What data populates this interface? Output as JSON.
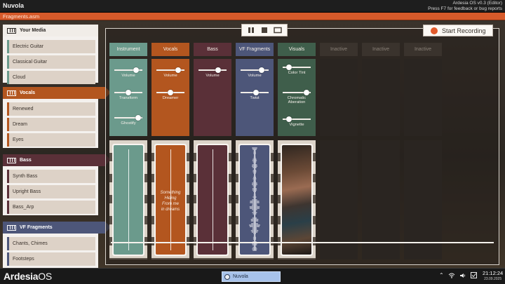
{
  "window": {
    "app_title": "Nuvola",
    "os_version": "Ardesia OS v0.3 (Editor)",
    "feedback_hint": "Press F7 for feedback or bug reports",
    "file_name": "Fragments.asm"
  },
  "sidebar": {
    "groups": [
      {
        "header": "Your Media",
        "color": "#f1ede8",
        "items": [
          {
            "label": "Electric Guitar",
            "color": "#6b9a8c"
          },
          {
            "label": "Classical Guitar",
            "color": "#6b9a8c"
          },
          {
            "label": "Cloud",
            "color": "#6b9a8c"
          }
        ]
      },
      {
        "header": "Vocals",
        "color": "#b3561f",
        "items": [
          {
            "label": "Renewed",
            "color": "#b3561f"
          },
          {
            "label": "Dream",
            "color": "#b3561f"
          },
          {
            "label": "Eyes",
            "color": "#b3561f"
          }
        ]
      },
      {
        "header": "Bass",
        "color": "#5a3038",
        "items": [
          {
            "label": "Synth Bass",
            "color": "#5a3038"
          },
          {
            "label": "Upright Bass",
            "color": "#5a3038"
          },
          {
            "label": "Bass_Arp",
            "color": "#5a3038"
          }
        ]
      },
      {
        "header": "VF Fragments",
        "color": "#4d5679",
        "items": [
          {
            "label": "Chants, Chimes",
            "color": "#4d5679"
          },
          {
            "label": "Footsteps",
            "color": "#4d5679"
          }
        ]
      }
    ]
  },
  "toolbar": {
    "pause_icon": "pause-icon",
    "stop_icon": "stop-icon",
    "loop_icon": "loop-icon",
    "record_label": "Start Recording",
    "record_color": "#e25a2b"
  },
  "tracks": [
    {
      "name": "Instrument",
      "color": "#6b9a8c",
      "active": true,
      "sliders": [
        {
          "label": "Volume",
          "value": 0.85
        },
        {
          "label": "Transform",
          "value": 0.5
        },
        {
          "label": "Ghostify",
          "value": 0.95
        }
      ]
    },
    {
      "name": "Vocals",
      "color": "#b3561f",
      "active": true,
      "lyrics": "Something\nHiding\nFrom me\nin dreams",
      "sliders": [
        {
          "label": "Volume",
          "value": 0.85
        },
        {
          "label": "Dreamer",
          "value": 0.5
        }
      ]
    },
    {
      "name": "Bass",
      "color": "#5a3038",
      "active": true,
      "sliders": [
        {
          "label": "Volume",
          "value": 0.75
        }
      ]
    },
    {
      "name": "VF Fragments",
      "color": "#4d5679",
      "active": true,
      "sliders": [
        {
          "label": "Volume",
          "value": 0.8
        },
        {
          "label": "Twist",
          "value": 0.55
        }
      ]
    },
    {
      "name": "Visuals",
      "color": "#3f5e4b",
      "active": true,
      "sliders": [
        {
          "label": "Color Tint",
          "value": 0.15
        },
        {
          "label": "Chromatic\nAberation",
          "value": 0.95
        },
        {
          "label": "Vignette",
          "value": 0.15
        }
      ]
    },
    {
      "name": "Inactive",
      "color": "#3a332d",
      "active": false,
      "sliders": []
    },
    {
      "name": "Inactive",
      "color": "#3a332d",
      "active": false,
      "sliders": []
    },
    {
      "name": "Inactive",
      "color": "#3a332d",
      "active": false,
      "sliders": []
    }
  ],
  "playhead_progress": 0.0,
  "taskbar": {
    "os_name_a": "Ardesia",
    "os_name_b": "OS",
    "task_label": "Nuvola",
    "tray_icons": [
      "chevron-up-icon",
      "wifi-icon",
      "volume-icon",
      "checkbox-icon"
    ],
    "time": "21:12:24",
    "date": "23.09.2025"
  }
}
